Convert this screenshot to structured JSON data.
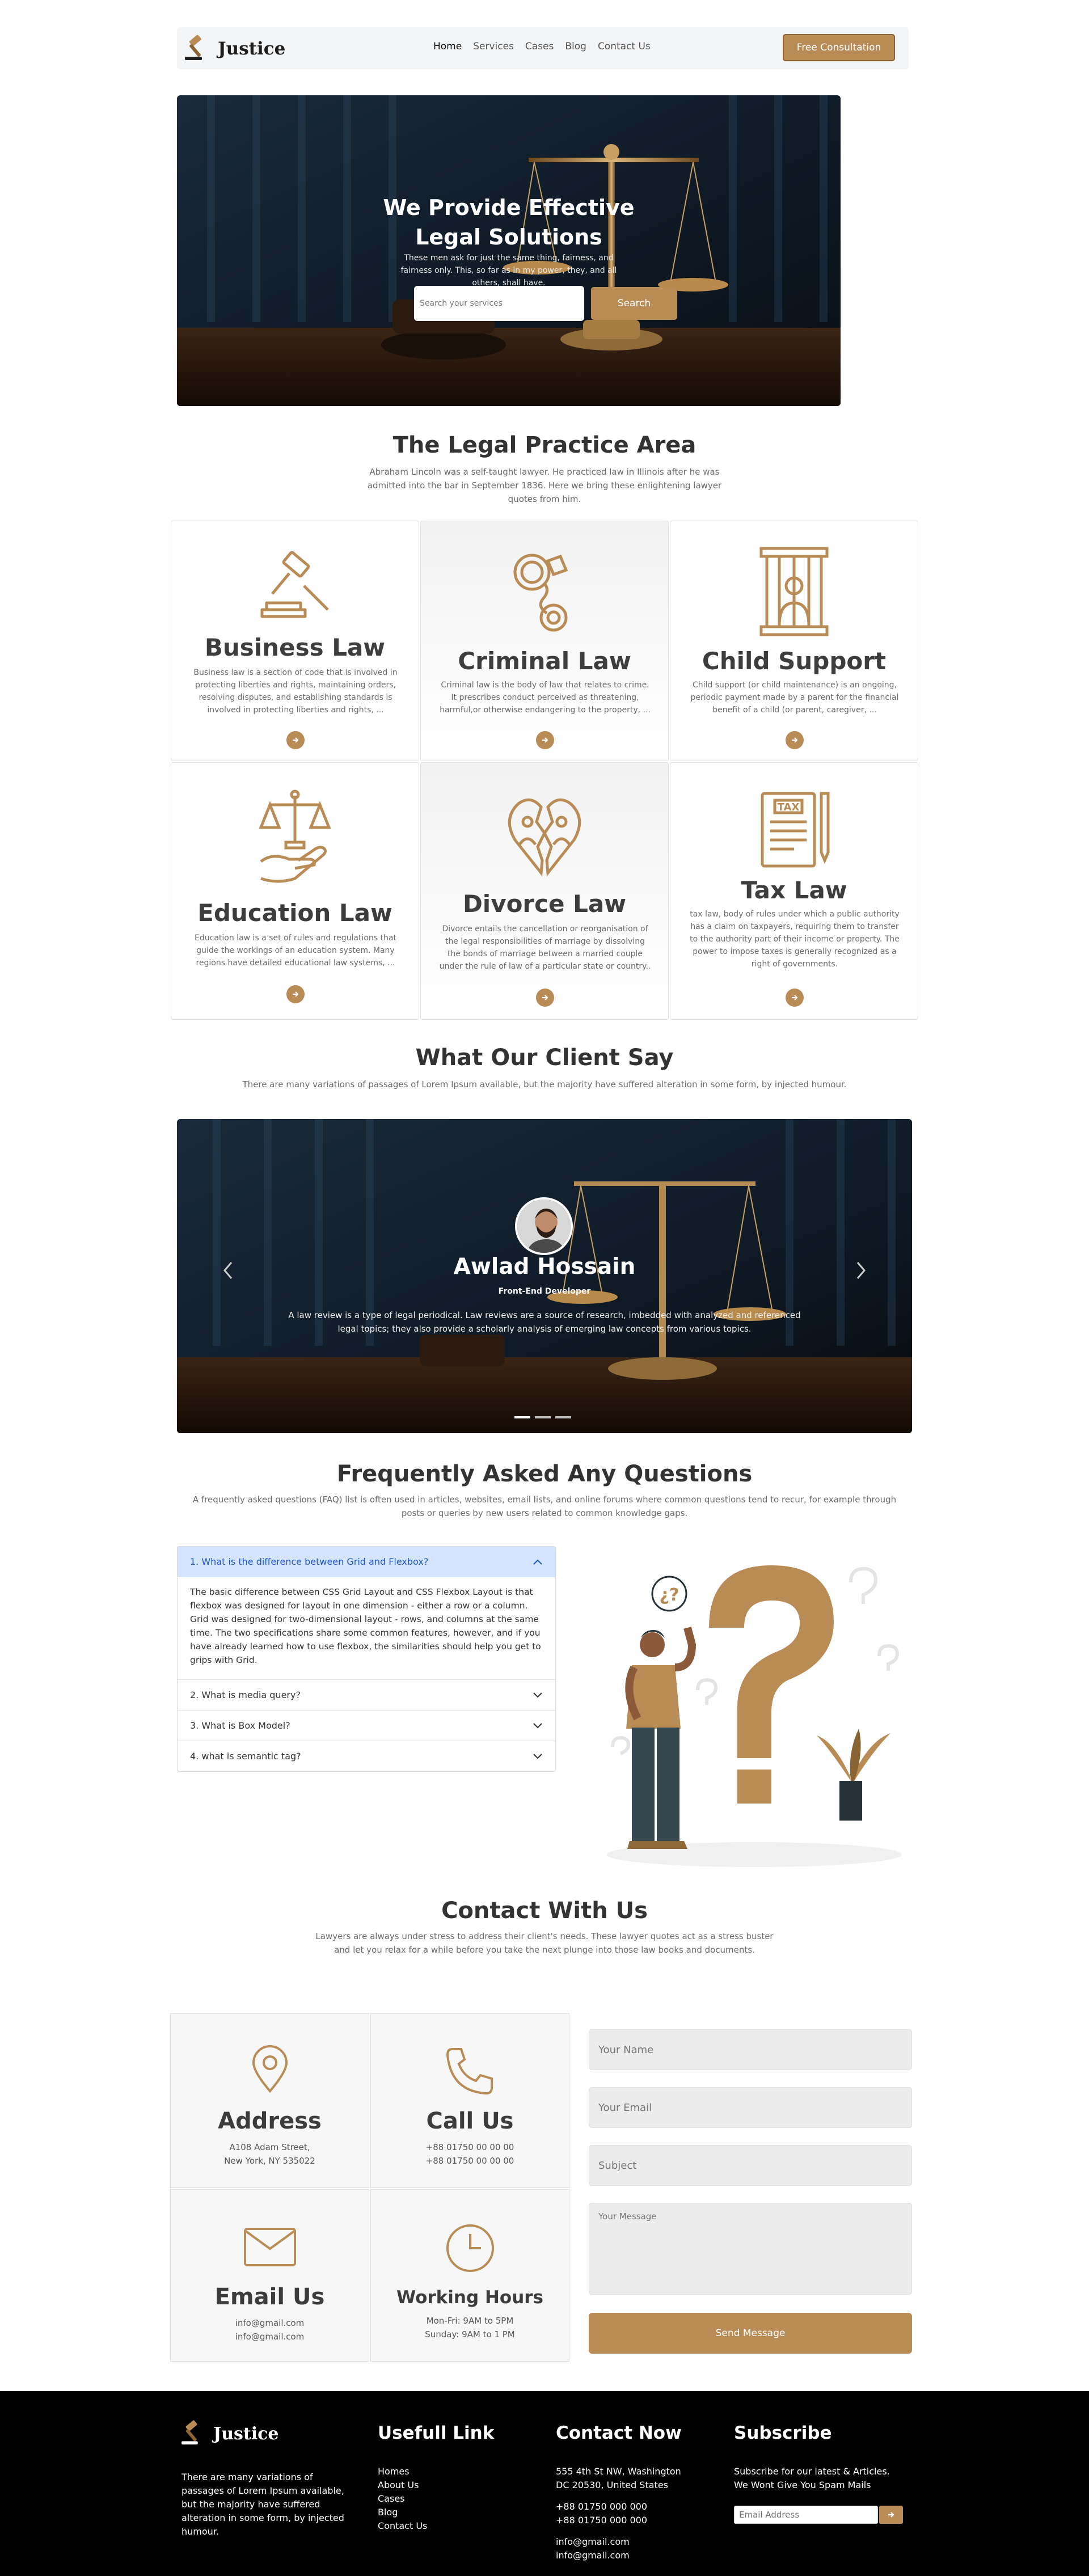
{
  "brand": {
    "name": "Justice"
  },
  "nav": {
    "links": [
      "Home",
      "Services",
      "Cases",
      "Blog",
      "Contact Us"
    ],
    "cta": "Free Consultation"
  },
  "hero": {
    "title_line1": "We Provide Effective",
    "title_line2": "Legal Solutions",
    "subtitle": "These men ask for just the same thing, fairness, and fairness only. This, so far as in my power, they, and all others, shall have.",
    "search_placeholder": "Search your services",
    "search_button": "Search"
  },
  "practice": {
    "title": "The Legal Practice Area",
    "subtitle": "Abraham Lincoln was a self-taught lawyer. He practiced law in Illinois after he was admitted into the bar in September 1836. Here we bring these enlightening lawyer quotes from him.",
    "cards": [
      {
        "title": "Business Law",
        "icon": "gavel-icon",
        "text": "Business law is a section of code that is involved in protecting liberties and rights, maintaining orders, resolving disputes, and establishing standards is involved in protecting liberties and rights, ..."
      },
      {
        "title": "Criminal Law",
        "icon": "handcuffs-icon",
        "text": "Criminal law is the body of law that relates to crime. It prescribes conduct perceived as threatening, harmful,or otherwise endangering to the property, ..."
      },
      {
        "title": "Child Support",
        "icon": "prisoner-icon",
        "text": "Child support (or child maintenance) is an ongoing, periodic payment made by a parent for the financial benefit of a child (or parent, caregiver, ..."
      },
      {
        "title": "Education Law",
        "icon": "scale-hand-icon",
        "text": "Education law is a set of rules and regulations that guide the workings of an education system. Many regions have detailed educational law systems, ..."
      },
      {
        "title": "Divorce Law",
        "icon": "broken-heart-icon",
        "text": "Divorce entails the cancellation or reorganisation of the legal responsibilities of marriage by dissolving the bonds of marriage between a married couple under the rule of law of a particular state or country.."
      },
      {
        "title": "Tax Law",
        "icon": "tax-document-icon",
        "text": "tax law, body of rules under which a public authority has a claim on taxpayers, requiring them to transfer to the authority part of their income or property. The power to impose taxes is generally recognized as a right of governments."
      }
    ]
  },
  "testimonials": {
    "title": "What Our Client Say",
    "subtitle": "There are many variations of passages of Lorem Ipsum available, but the majority have suffered alteration in some form, by injected humour.",
    "name": "Awlad Hossain",
    "role": "Front-End Developer",
    "text": "A law review is a type of legal periodical. Law reviews are a source of research, imbedded with analyzed and referenced legal topics; they also provide a scholarly analysis of emerging law concepts from various topics.",
    "prev_icon": "chevron-left-icon",
    "next_icon": "chevron-right-icon"
  },
  "faq": {
    "title": "Frequently Asked Any Questions",
    "subtitle": "A frequently asked questions (FAQ) list is often used in articles, websites, email lists, and online forums where common questions tend to recur, for example through posts or queries by new users related to common knowledge gaps.",
    "items": [
      {
        "q": "1. What is the difference between Grid and Flexbox?",
        "a": "The basic difference between CSS Grid Layout and CSS Flexbox Layout is that flexbox was designed for layout in one dimension - either a row or a column. Grid was designed for two-dimensional layout - rows, and columns at the same time. The two specifications share some common features, however, and if you have already learned how to use flexbox, the similarities should help you get to grips with Grid."
      },
      {
        "q": "2. What is media query?"
      },
      {
        "q": "3. What is Box Model?"
      },
      {
        "q": "4. what is semantic tag?"
      }
    ]
  },
  "contact": {
    "title": "Contact With Us",
    "subtitle": "Lawyers are always under stress to address their client's needs. These lawyer quotes act as a stress buster and let you relax for a while before you take the next plunge into those law books and documents.",
    "address": {
      "title": "Address",
      "line1": "A108 Adam Street,",
      "line2": "New York, NY 535022"
    },
    "call": {
      "title": "Call Us",
      "line1": "+88 01750 00 00 00",
      "line2": "+88 01750 00 00 00"
    },
    "email": {
      "title": "Email Us",
      "line1": "info@gmail.com",
      "line2": "info@gmail.com"
    },
    "hours": {
      "title": "Working Hours",
      "line1": "Mon-Fri: 9AM to 5PM",
      "line2": "Sunday: 9AM to 1 PM"
    },
    "form": {
      "name_placeholder": "Your Name",
      "email_placeholder": "Your Email",
      "subject_placeholder": "Subject",
      "message_placeholder": "Your Message",
      "send_button": "Send Message"
    }
  },
  "footer": {
    "brand": "Justice",
    "about": "There are many variations of passages of Lorem Ipsum available, but the majority have suffered alteration in some form, by injected humour.",
    "links_title": "Usefull Link",
    "links": [
      "Homes",
      "About Us",
      "Cases",
      "Blog",
      "Contact Us"
    ],
    "contact_title": "Contact Now",
    "address_line1": "555 4th St NW, Washington",
    "address_line2": "DC 20530, United States",
    "phone1": "+88 01750 000 000",
    "phone2": "+88 01750 000 000",
    "email1": "info@gmail.com",
    "email2": "info@gmail.com",
    "subscribe_title": "Subscribe",
    "subscribe_text": "Subscribe for our latest & Articles. We Wont Give You Spam Mails",
    "email_placeholder": "Email Address"
  },
  "colors": {
    "accent": "#b98b55",
    "accent_dark": "#8b6434",
    "faq_open_bg": "#d5e5ff",
    "footer_bg": "#000000"
  }
}
